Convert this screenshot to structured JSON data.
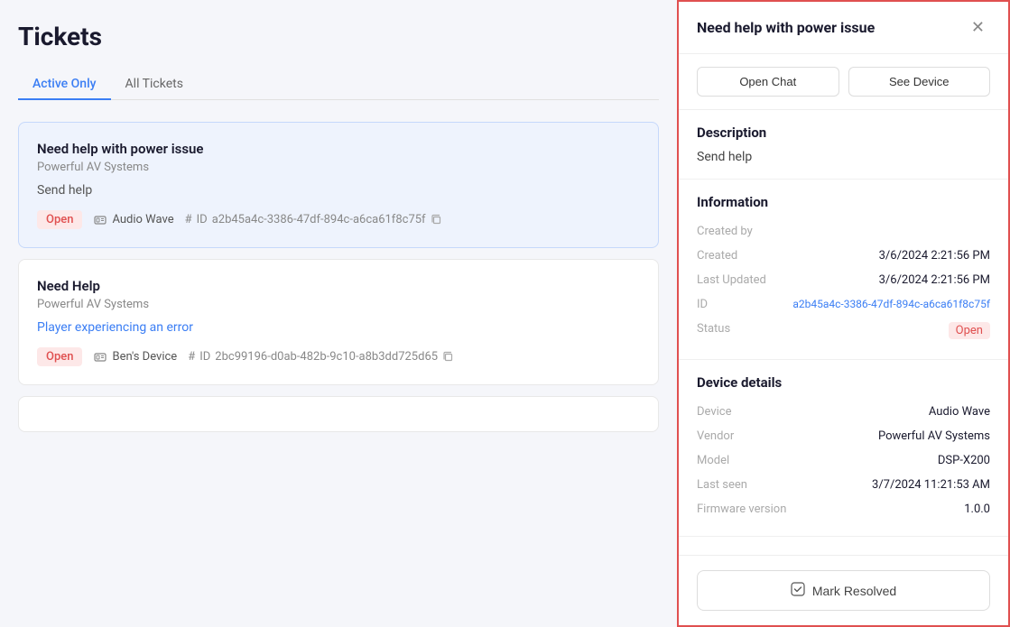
{
  "page": {
    "title": "Tickets"
  },
  "tabs": [
    {
      "id": "active",
      "label": "Active Only",
      "active": true
    },
    {
      "id": "all",
      "label": "All Tickets",
      "active": false
    }
  ],
  "tickets": [
    {
      "id": "ticket-1",
      "title": "Need help with power issue",
      "company": "Powerful AV Systems",
      "description": "Send help",
      "description_style": "normal",
      "status": "Open",
      "device": "Audio Wave",
      "ticket_id": "a2b45a4c-3386-47df-894c-a6ca61f8c75f",
      "selected": true
    },
    {
      "id": "ticket-2",
      "title": "Need Help",
      "company": "Powerful AV Systems",
      "description": "Player experiencing an error",
      "description_style": "link",
      "status": "Open",
      "device": "Ben's Device",
      "ticket_id": "2bc99196-d0ab-482b-9c10-a8b3dd725d65",
      "selected": false
    }
  ],
  "detail_panel": {
    "title": "Need help with power issue",
    "btn_open_chat": "Open Chat",
    "btn_see_device": "See Device",
    "description_label": "Description",
    "description_text": "Send help",
    "information_label": "Information",
    "created_by_label": "Created by",
    "created_by_value": "",
    "created_label": "Created",
    "created_value": "3/6/2024 2:21:56 PM",
    "last_updated_label": "Last Updated",
    "last_updated_value": "3/6/2024 2:21:56 PM",
    "id_label": "ID",
    "id_value": "a2b45a4c-3386-47df-894c-a6ca61f8c75f",
    "status_label": "Status",
    "status_value": "Open",
    "device_details_label": "Device details",
    "device_label": "Device",
    "device_value": "Audio Wave",
    "vendor_label": "Vendor",
    "vendor_value": "Powerful AV Systems",
    "model_label": "Model",
    "model_value": "DSP-X200",
    "last_seen_label": "Last seen",
    "last_seen_value": "3/7/2024 11:21:53 AM",
    "firmware_label": "Firmware version",
    "firmware_value": "1.0.0",
    "mark_resolved_label": "Mark Resolved"
  }
}
